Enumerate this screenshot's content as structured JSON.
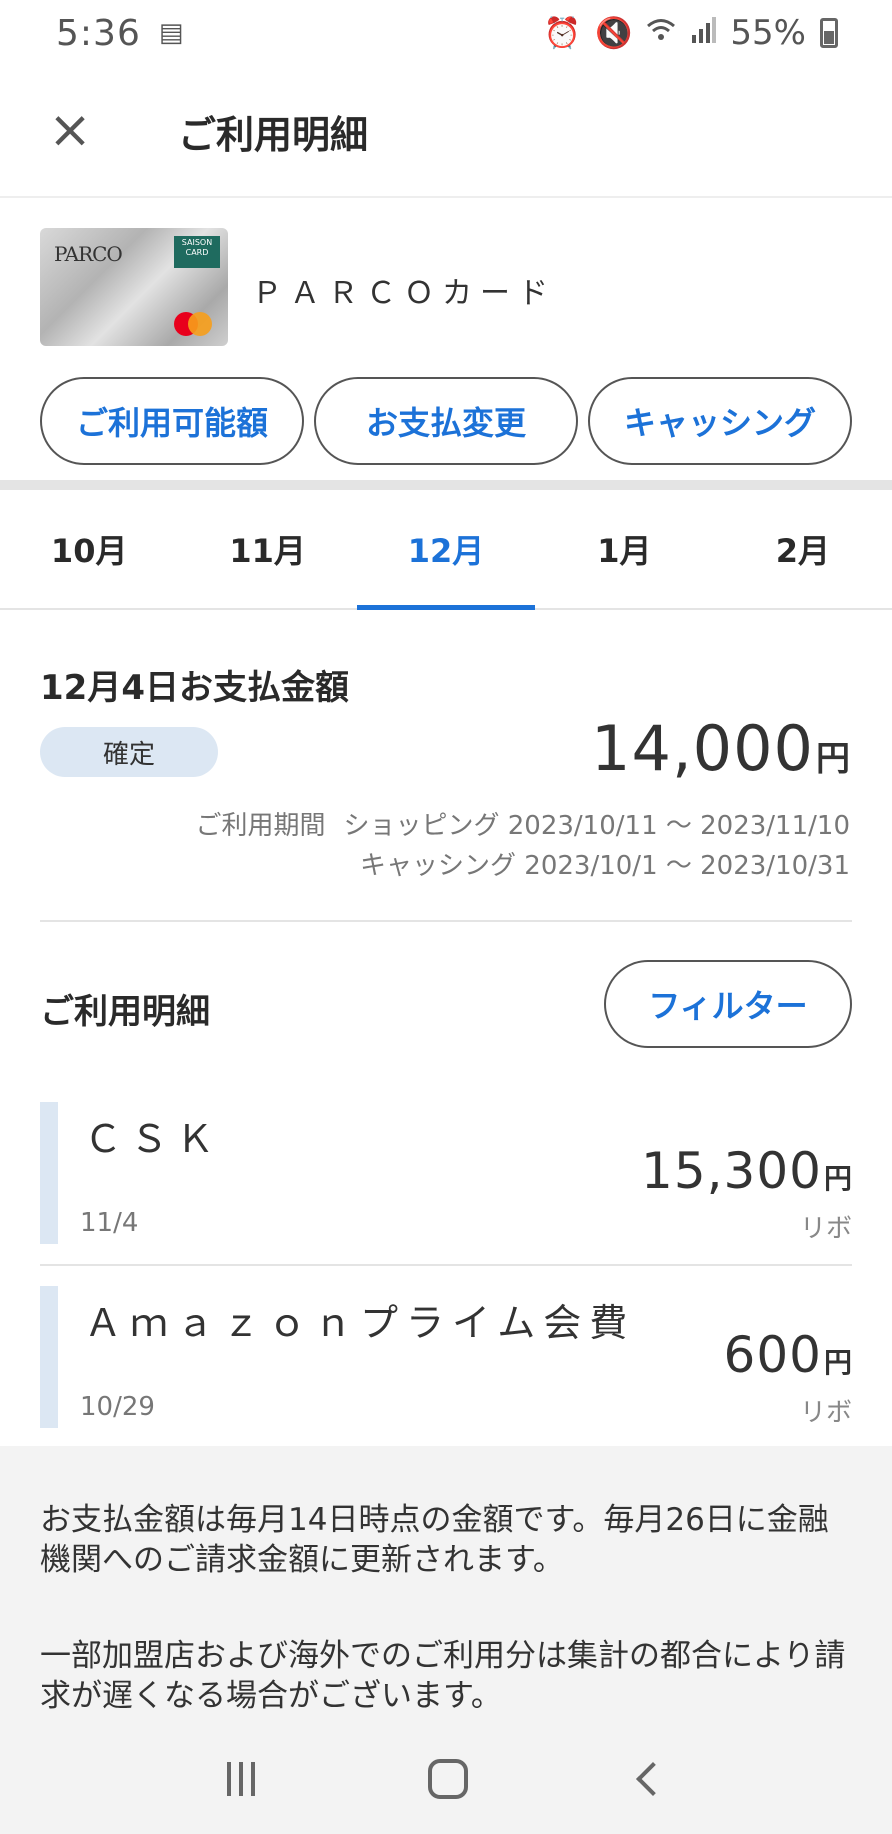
{
  "status_bar": {
    "time": "5:36",
    "battery": "55%",
    "icons": [
      "notification-icon",
      "alarm-icon",
      "mute-icon",
      "wifi-icon",
      "signal-icon",
      "battery-icon"
    ]
  },
  "header": {
    "title": "ご利用明細",
    "close_icon": "close-icon"
  },
  "card": {
    "brand_text": "PARCO",
    "saison_text": "SAISON CARD INTERNATIONAL",
    "name": "ＰＡＲＣＯカード"
  },
  "actions": [
    {
      "label": "ご利用可能額"
    },
    {
      "label": "お支払変更"
    },
    {
      "label": "キャッシング"
    }
  ],
  "months": [
    {
      "label": "10月"
    },
    {
      "label": "11月"
    },
    {
      "label": "12月",
      "active": true
    },
    {
      "label": "1月"
    },
    {
      "label": "2月"
    }
  ],
  "payment": {
    "title": "12月4日お支払金額",
    "status": "確定",
    "amount": "14,000",
    "currency": "円",
    "period_label": "ご利用期間",
    "period_shopping": "ショッピング 2023/10/11 ～ 2023/11/10",
    "period_cashing": "キャッシング 2023/10/1 ～ 2023/10/31"
  },
  "details": {
    "title": "ご利用明細",
    "filter_label": "フィルター",
    "transactions": [
      {
        "merchant": "ＣＳＫ",
        "date": "11/4",
        "amount": "15,300",
        "currency": "円",
        "plan": "リボ"
      },
      {
        "merchant": "Ａｍａｚｏｎプライム会費",
        "date": "10/29",
        "amount": "600",
        "currency": "円",
        "plan": "リボ"
      }
    ]
  },
  "notice": {
    "line1": "お支払金額は毎月14日時点の金額です。毎月26日に金融機関へのご請求金額に更新されます。",
    "line2": "一部加盟店および海外でのご利用分は集計の都合により請求が遅くなる場合がございます。"
  },
  "colors": {
    "accent": "#1c72d8",
    "badge_bg": "#dce7f3",
    "notice_bg": "#f3f3f3"
  }
}
